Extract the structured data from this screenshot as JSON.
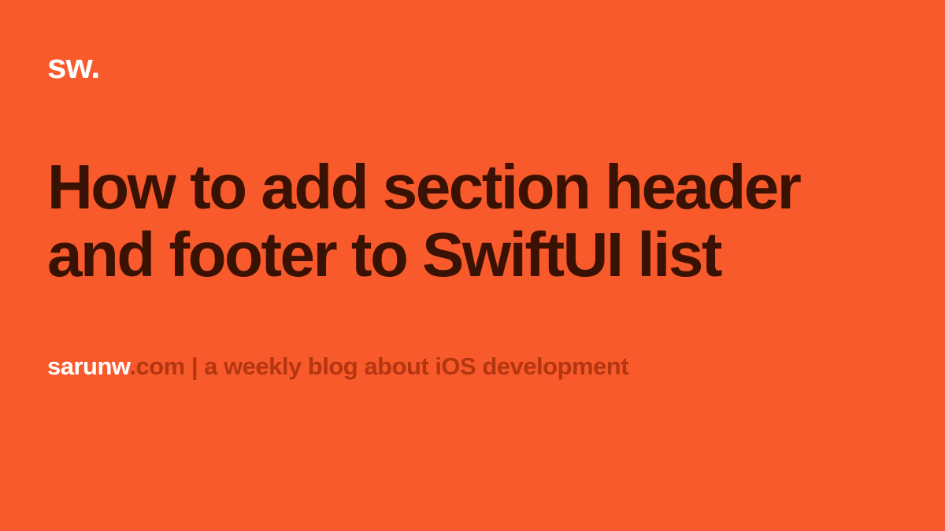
{
  "logo": "sw.",
  "title": "How to add section header and footer to SwiftUI list",
  "footer": {
    "brand": "sarunw",
    "rest": ".com | a weekly blog about iOS development"
  }
}
